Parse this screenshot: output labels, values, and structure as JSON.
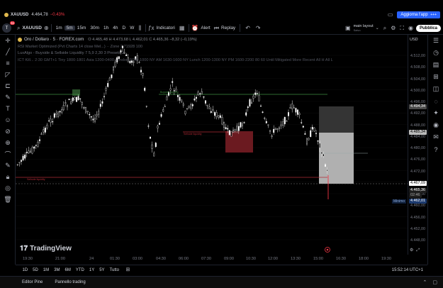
{
  "topbar": {
    "symbol": "XAUUSD",
    "price": "4.464,78",
    "change": "−0.43%",
    "upgrade_label": "Aggiorna l'app",
    "upgrade_extra": "+++"
  },
  "toolbar": {
    "avatar_badge": "11",
    "symbol": "XAUUSD",
    "intervals": [
      "1m",
      "5m",
      "15m",
      "30m",
      "1h",
      "4h",
      "D",
      "W"
    ],
    "selected_interval": "5m",
    "indicators_label": "Indicatori",
    "alert_label": "Alert",
    "replay_label": "Replay",
    "layout_name": "main layout",
    "layout_sub": "Salvo",
    "publish_label": "Pubblica"
  },
  "legend": {
    "title": "Oro / Dollaro · 5 · FOREX.com",
    "ohlc": "O 4.465,48  H 4.473,68  L 4.462,01  C 4.465,36  −8,32 (−0,19%)",
    "ind1": "RSI Market Optimized (Pvt Charts 14 close Mel...) ·· Zone 2 71928 100",
    "ind2": "LuxAlgo - Buyside & Sellside Liquidity 7 5,9 2,30 3 Presets 3",
    "ind3": "ICT Kill... 2:30 GMT+1 Tiny 1800-1801 Asia 1200-0400 London 0700-1000 NY AM 1630-1600 NY Lunch 1200-1300 NY PM 1600-2200 80 60 Until Mitigated More Recent All H All L"
  },
  "annotations": {
    "buyside": "Buyside liquidity",
    "sellside1": "Sellside liquidity",
    "sellside2": "Sellside liquidity"
  },
  "price_axis": {
    "currency": "USD",
    "labels": [
      "4.512,00",
      "4.508,00",
      "4.504,00",
      "4.500,00",
      "4.496,00",
      "4.492,00",
      "4.488,00",
      "4.484,00",
      "4.480,00",
      "4.476,00",
      "4.472,00",
      "4.468,00",
      "4.464,00",
      "4.460,00",
      "4.456,00",
      "4.452,00",
      "4.448,00"
    ],
    "tag_upper": "4.494,34",
    "tag_mid": "4.485,34",
    "tag_last": "4.467,09",
    "tag_current": "4.465,36",
    "tag_countdown": "02:46",
    "tag_min": "4.462,01",
    "min_label": "Minimo"
  },
  "time_axis": {
    "labels": [
      "19:30",
      "21:00",
      "24",
      "01:30",
      "03:00",
      "04:30",
      "06:00",
      "07:30",
      "09:00",
      "10:30",
      "12:00",
      "13:30",
      "15:00",
      "16:30",
      "18:00",
      "19:30"
    ]
  },
  "bottombar": {
    "ranges": [
      "1D",
      "5D",
      "1M",
      "3M",
      "6M",
      "YTD",
      "1Y",
      "5Y",
      "Tutto"
    ],
    "clock": "15:52:14 UTC+1"
  },
  "footer": {
    "tab1": "Editor Pine",
    "tab2": "Pannello trading"
  },
  "watermark": "TradingView",
  "colors": {
    "up": "#ffffff",
    "down": "#ffffff",
    "accent": "#2962ff",
    "sell_zone": "#6b1a20",
    "buy_line": "#3e8e41",
    "sell_line": "#b22a35",
    "red": "#f23645"
  }
}
